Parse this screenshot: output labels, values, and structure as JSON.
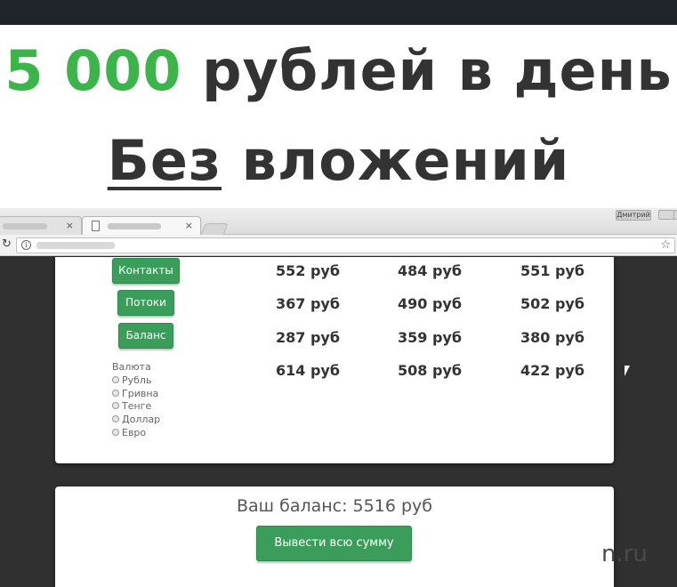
{
  "headline": {
    "line1_accent": "5 000",
    "line1_rest": " рублей в день",
    "line2_underlined": "Без",
    "line2_rest": " вложений",
    "accent_color": "#3bb44a"
  },
  "browser": {
    "profile_label": "Дмитрий",
    "tab_close": "×",
    "reload_icon": "↻",
    "star_icon": "☆",
    "info_icon": "i"
  },
  "sidebar": {
    "buttons": [
      "Контакты",
      "Потоки",
      "Баланс"
    ],
    "currency_title": "Валюта",
    "currency_options": [
      "Рубль",
      "Гривна",
      "Тенге",
      "Доллар",
      "Евро"
    ]
  },
  "prices": [
    [
      "552 руб",
      "484 руб",
      "551 руб"
    ],
    [
      "367 руб",
      "490 руб",
      "502 руб"
    ],
    [
      "287 руб",
      "359 руб",
      "380 руб"
    ],
    [
      "614 руб",
      "508 руб",
      "422 руб"
    ]
  ],
  "balance": {
    "label": "Ваш баланс: 5516 руб",
    "withdraw_button": "Вывести всю сумму",
    "button_color": "#3a9e5a"
  },
  "watermark": "n.ru"
}
